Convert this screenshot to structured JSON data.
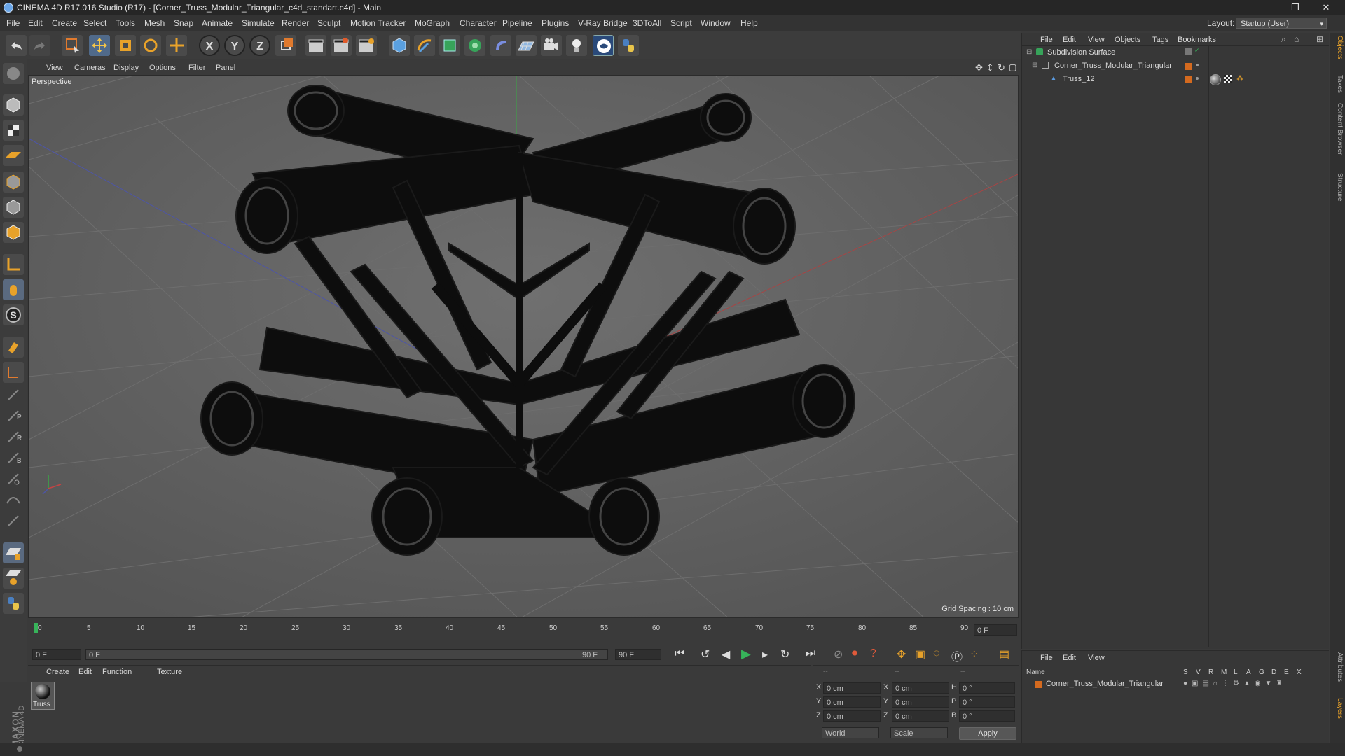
{
  "window": {
    "title": "CINEMA 4D R17.016 Studio (R17) - [Corner_Truss_Modular_Triangular_c4d_standart.c4d] - Main",
    "min": "–",
    "max": "❐",
    "close": "✕"
  },
  "menubar": {
    "items": [
      "File",
      "Edit",
      "Create",
      "Select",
      "Tools",
      "Mesh",
      "Snap",
      "Animate",
      "Simulate",
      "Render",
      "Sculpt",
      "Motion Tracker",
      "MoGraph",
      "Character",
      "Pipeline",
      "Plugins",
      "V-Ray Bridge",
      "3DToAll",
      "Script",
      "Window",
      "Help"
    ],
    "layout_label": "Layout:",
    "layout_value": "Startup (User)"
  },
  "toolbar": {
    "axis_x": "X",
    "axis_y": "Y",
    "axis_z": "Z"
  },
  "viewport": {
    "menu": [
      "View",
      "Cameras",
      "Display",
      "Options",
      "Filter",
      "Panel"
    ],
    "label": "Perspective",
    "grid_spacing": "Grid Spacing : 10 cm"
  },
  "timeline": {
    "ticks": [
      "0",
      "5",
      "10",
      "15",
      "20",
      "25",
      "30",
      "35",
      "40",
      "45",
      "50",
      "55",
      "60",
      "65",
      "70",
      "75",
      "80",
      "85",
      "90"
    ],
    "current_frame": "0 F",
    "start_field": "0 F",
    "slider_start": "0 F",
    "slider_end": "90 F",
    "end_field": "90 F"
  },
  "material_panel": {
    "menu": [
      "Create",
      "Edit",
      "Function",
      "Texture"
    ],
    "material_name": "Truss"
  },
  "coords": {
    "header": [
      "--",
      "--",
      "--"
    ],
    "rows": [
      {
        "a": "X",
        "av": "0 cm",
        "b": "X",
        "bv": "0 cm",
        "c": "H",
        "cv": "0 °"
      },
      {
        "a": "Y",
        "av": "0 cm",
        "b": "Y",
        "bv": "0 cm",
        "c": "P",
        "cv": "0 °"
      },
      {
        "a": "Z",
        "av": "0 cm",
        "b": "Z",
        "bv": "0 cm",
        "c": "B",
        "cv": "0 °"
      }
    ],
    "world": "World",
    "scale": "Scale",
    "apply": "Apply"
  },
  "object_manager": {
    "menu": [
      "File",
      "Edit",
      "View",
      "Objects",
      "Tags",
      "Bookmarks"
    ],
    "objects": [
      {
        "name": "Subdivision Surface"
      },
      {
        "name": "Corner_Truss_Modular_Triangular"
      },
      {
        "name": "Truss_12"
      }
    ]
  },
  "attribute_manager": {
    "menu": [
      "File",
      "Edit",
      "View"
    ],
    "columns": [
      "Name",
      "S",
      "V",
      "R",
      "M",
      "L",
      "A",
      "G",
      "D",
      "E",
      "X"
    ],
    "row": "Corner_Truss_Modular_Triangular"
  },
  "side_tabs": [
    "Objects",
    "Takes",
    "Content Browser",
    "Structure",
    "Attributes",
    "Layers"
  ],
  "branding": {
    "maxon": "MAXON",
    "cinema": "CINEMA 4D"
  },
  "colors": {
    "accent": "#d46a1f",
    "selected": "#5b7fb2"
  }
}
